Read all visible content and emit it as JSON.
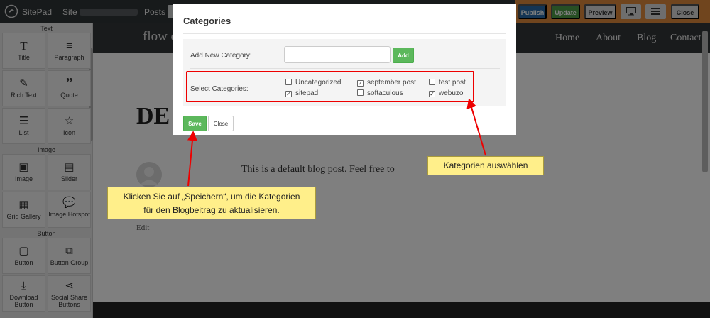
{
  "topbar": {
    "app_name": "SitePad",
    "site_label": "Site :",
    "posts_label": "Posts :",
    "buttons": {
      "publish": "Publish",
      "update": "Update",
      "preview": "Preview",
      "close": "Close"
    }
  },
  "sidebar": {
    "sections": {
      "text": "Text",
      "image": "Image",
      "button": "Button"
    },
    "widgets": {
      "title": "Title",
      "paragraph": "Paragraph",
      "rich_text": "Rich Text",
      "quote": "Quote",
      "list": "List",
      "icon": "Icon",
      "image": "Image",
      "slider": "Slider",
      "grid_gallery": "Grid Gallery",
      "image_hotspot": "Image Hotspot",
      "button": "Button",
      "button_group": "Button Group",
      "download_button": "Download Button",
      "social_share_buttons": "Social Share Buttons"
    }
  },
  "site": {
    "brand": "flow c",
    "nav": {
      "home": "Home",
      "about": "About",
      "blog": "Blog",
      "contact": "Contact"
    },
    "hero": "DE",
    "post_text": "This is a default blog post. Feel free to",
    "edit": "Edit"
  },
  "modal": {
    "title": "Categories",
    "add_label": "Add New Category:",
    "add_value": "",
    "add_button": "Add",
    "select_label": "Select Categories:",
    "categories": [
      {
        "name": "Uncategorized",
        "checked": false
      },
      {
        "name": "september post",
        "checked": true
      },
      {
        "name": "test post",
        "checked": false
      },
      {
        "name": "sitepad",
        "checked": true
      },
      {
        "name": "softaculous",
        "checked": false
      },
      {
        "name": "webuzo",
        "checked": true
      }
    ],
    "save_button": "Save",
    "close_button": "Close"
  },
  "annotations": {
    "select_categories": "Kategorien auswählen",
    "save_line1": "Klicken Sie auf „Speichern“, um die Kategorien",
    "save_line2": "für den Blogbeitrag zu aktualisieren.",
    "highlight_color": "#ee0000",
    "callout_color": "#ffef8a"
  },
  "colors": {
    "primary_green": "#5cb85c",
    "publish_blue": "#2a6ba8",
    "topbar_bg": "#2f3437"
  }
}
